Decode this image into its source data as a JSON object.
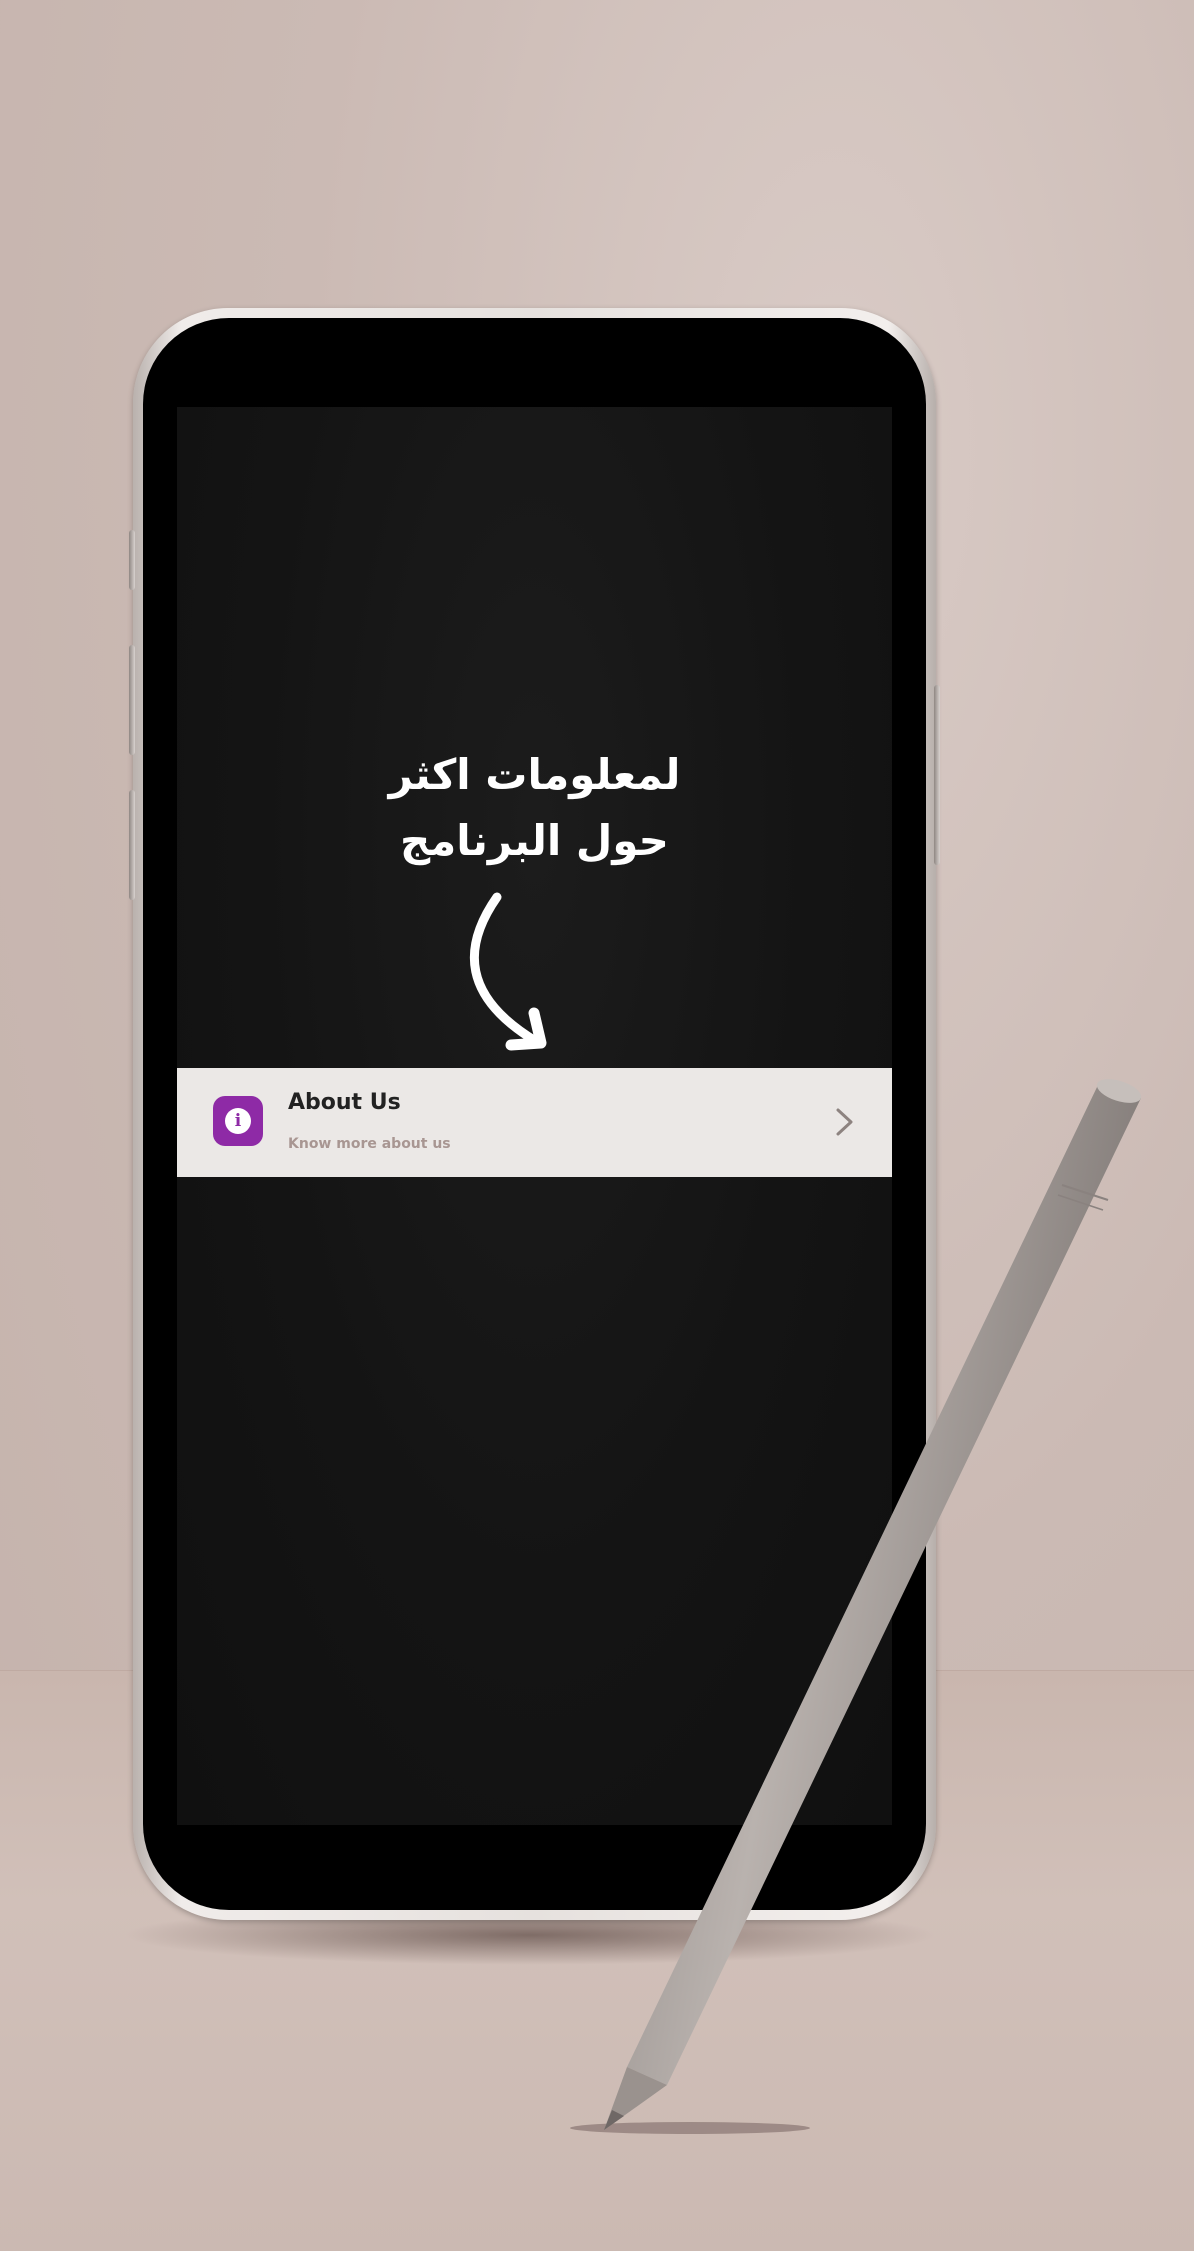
{
  "overlay": {
    "headline_line1": "لمعلومات اكثر",
    "headline_line2": "حول البرنامج"
  },
  "settings_item": {
    "icon": "info-icon",
    "icon_glyph": "i",
    "title": "About Us",
    "subtitle": "Know more about us",
    "chevron": "chevron-right-icon"
  },
  "colors": {
    "icon_background": "#8e2aa6",
    "row_background": "#ebe8e6",
    "screen_background": "#141414",
    "headline_text": "#ffffff",
    "subtitle_text": "#a89692"
  }
}
